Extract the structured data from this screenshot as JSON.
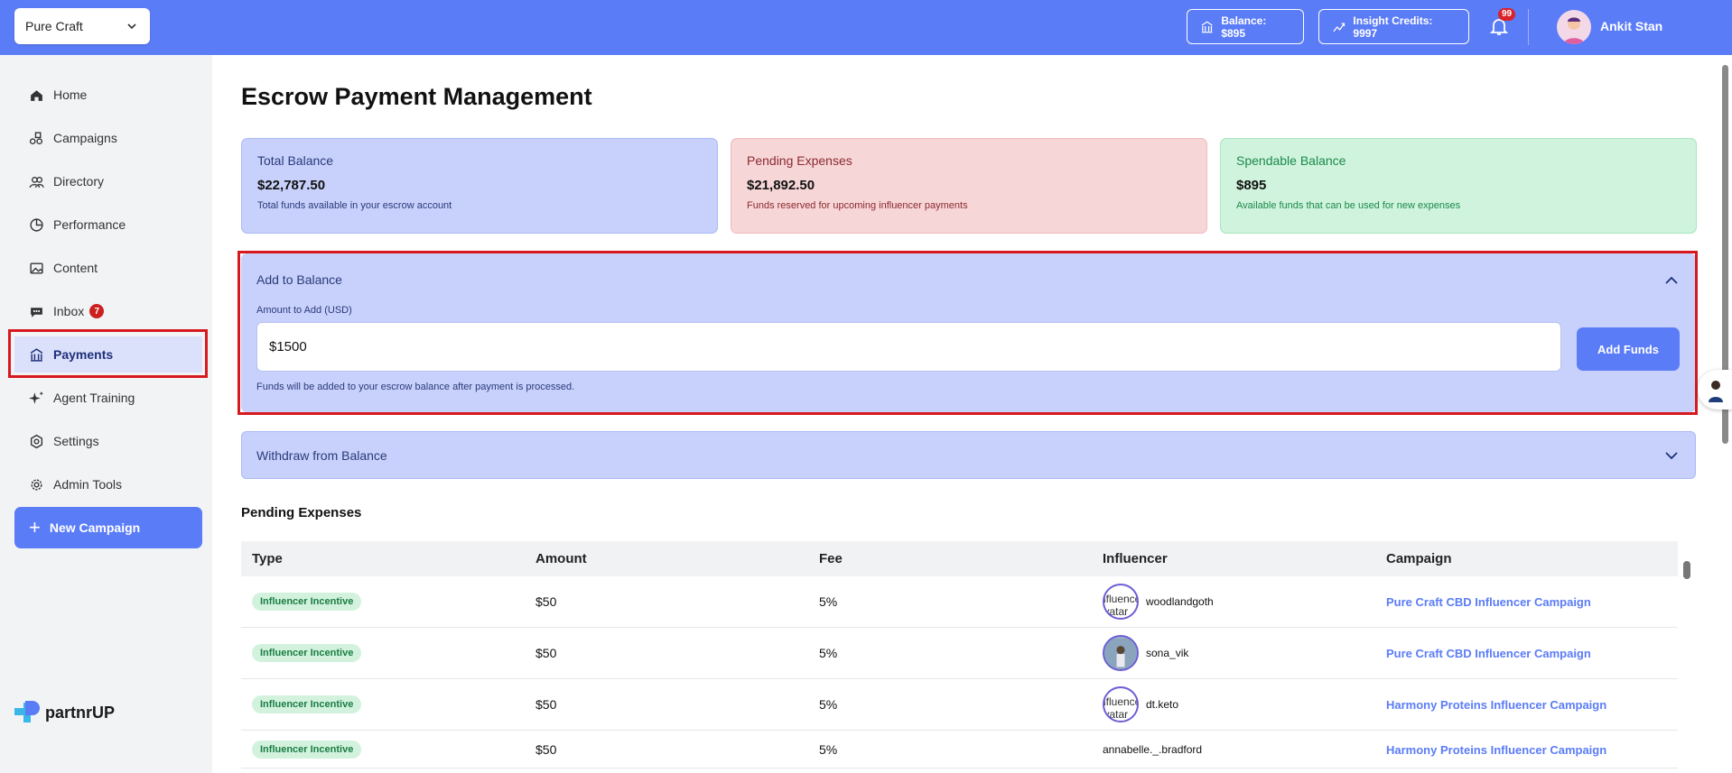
{
  "header": {
    "brand_selected": "Pure Craft",
    "balance_label": "Balance: $895",
    "insight_label": "Insight Credits: 9997",
    "notification_count": "99",
    "user_name": "Ankit Stan"
  },
  "sidebar": {
    "items": [
      {
        "label": "Home",
        "icon": "home-icon"
      },
      {
        "label": "Campaigns",
        "icon": "campaigns-icon"
      },
      {
        "label": "Directory",
        "icon": "directory-icon"
      },
      {
        "label": "Performance",
        "icon": "performance-icon"
      },
      {
        "label": "Content",
        "icon": "content-icon"
      },
      {
        "label": "Inbox",
        "icon": "inbox-icon",
        "badge": "7"
      },
      {
        "label": "Payments",
        "icon": "payments-icon",
        "active": true
      },
      {
        "label": "Agent Training",
        "icon": "sparkle-icon"
      },
      {
        "label": "Settings",
        "icon": "settings-icon"
      },
      {
        "label": "Admin Tools",
        "icon": "gear-icon"
      }
    ],
    "new_campaign_label": "New Campaign",
    "logo_text": "partnrUP"
  },
  "main": {
    "title": "Escrow Payment Management",
    "cards": {
      "total": {
        "title": "Total Balance",
        "value": "$22,787.50",
        "desc": "Total funds available in your escrow account"
      },
      "pending": {
        "title": "Pending Expenses",
        "value": "$21,892.50",
        "desc": "Funds reserved for upcoming influencer payments"
      },
      "spendable": {
        "title": "Spendable Balance",
        "value": "$895",
        "desc": "Available funds that can be used for new expenses"
      }
    },
    "add_balance": {
      "title": "Add to Balance",
      "amount_label": "Amount to Add (USD)",
      "amount_value": "$1500",
      "button_label": "Add Funds",
      "note": "Funds will be added to your escrow balance after payment is processed."
    },
    "withdraw": {
      "title": "Withdraw from Balance"
    },
    "pending_expenses": {
      "title": "Pending Expenses",
      "columns": [
        "Type",
        "Amount",
        "Fee",
        "Influencer",
        "Campaign"
      ],
      "rows": [
        {
          "type": "Influencer Incentive",
          "amount": "$50",
          "fee": "5%",
          "influencer": "woodlandgoth",
          "avatar_alt": "Influencer Avatar",
          "campaign": "Pure Craft CBD Influencer Campaign"
        },
        {
          "type": "Influencer Incentive",
          "amount": "$50",
          "fee": "5%",
          "influencer": "sona_vik",
          "avatar_alt": "",
          "campaign": "Pure Craft CBD Influencer Campaign"
        },
        {
          "type": "Influencer Incentive",
          "amount": "$50",
          "fee": "5%",
          "influencer": "dt.keto",
          "avatar_alt": "Influencer Avatar",
          "campaign": "Harmony Proteins Influencer Campaign"
        },
        {
          "type": "Influencer Incentive",
          "amount": "$50",
          "fee": "5%",
          "influencer": "annabelle._.bradford",
          "avatar_alt": "",
          "campaign": "Harmony Proteins Influencer Campaign"
        }
      ]
    }
  },
  "colors": {
    "accent": "#5b7cf7",
    "highlight": "#d7191f"
  }
}
